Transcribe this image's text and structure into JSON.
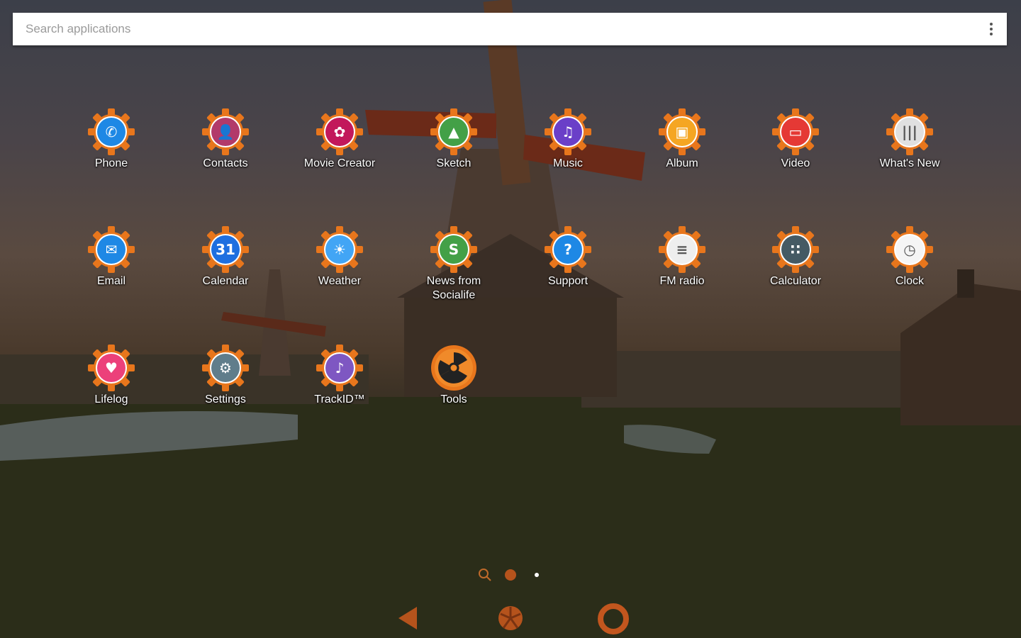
{
  "search": {
    "placeholder": "Search applications",
    "menu_icon": "more-vert-icon"
  },
  "accent_color": "#e8761c",
  "apps": [
    {
      "label": "Phone",
      "icon": "phone-icon",
      "color": "#1e88e5",
      "glyph": "✆"
    },
    {
      "label": "Contacts",
      "icon": "contacts-icon",
      "color": "#b23a6a",
      "glyph": "👤"
    },
    {
      "label": "Movie Creator",
      "icon": "movie-creator-icon",
      "color": "#c2185b",
      "glyph": "✿"
    },
    {
      "label": "Sketch",
      "icon": "sketch-icon",
      "color": "#43a047",
      "glyph": "▲"
    },
    {
      "label": "Music",
      "icon": "music-icon",
      "color": "#6a3fc8",
      "glyph": "♫"
    },
    {
      "label": "Album",
      "icon": "album-icon",
      "color": "#f5a623",
      "glyph": "▣"
    },
    {
      "label": "Video",
      "icon": "video-icon",
      "color": "#e53935",
      "glyph": "▭"
    },
    {
      "label": "What's New",
      "icon": "whats-new-icon",
      "color": "#e0e0e0",
      "glyph": "|||"
    },
    {
      "label": "Email",
      "icon": "email-icon",
      "color": "#1e88e5",
      "glyph": "✉"
    },
    {
      "label": "Calendar",
      "icon": "calendar-icon",
      "color": "#1e6fe0",
      "glyph": "31"
    },
    {
      "label": "Weather",
      "icon": "weather-icon",
      "color": "#42a5f5",
      "glyph": "☀"
    },
    {
      "label": "News from\nSocialife",
      "icon": "news-icon",
      "color": "#43a047",
      "glyph": "S"
    },
    {
      "label": "Support",
      "icon": "support-icon",
      "color": "#1e88e5",
      "glyph": "?"
    },
    {
      "label": "FM radio",
      "icon": "fm-radio-icon",
      "color": "#eeeeee",
      "glyph": "≡"
    },
    {
      "label": "Calculator",
      "icon": "calculator-icon",
      "color": "#455a64",
      "glyph": "∷"
    },
    {
      "label": "Clock",
      "icon": "clock-icon",
      "color": "#f5f5f5",
      "glyph": "◷"
    },
    {
      "label": "Lifelog",
      "icon": "lifelog-icon",
      "color": "#ec407a",
      "glyph": "♥"
    },
    {
      "label": "Settings",
      "icon": "settings-icon",
      "color": "#607d8b",
      "glyph": "⚙"
    },
    {
      "label": "TrackID™",
      "icon": "trackid-icon",
      "color": "#7e57c2",
      "glyph": "♪"
    },
    {
      "label": "Tools",
      "icon": "radiation-icon",
      "color": "#e8761c",
      "glyph": "☢"
    }
  ],
  "page_indicators": [
    "search-indicator-icon",
    "page-dot-active",
    "page-dot"
  ],
  "navigation": {
    "back": "back-icon",
    "home": "home-icon",
    "recents": "recents-icon"
  }
}
